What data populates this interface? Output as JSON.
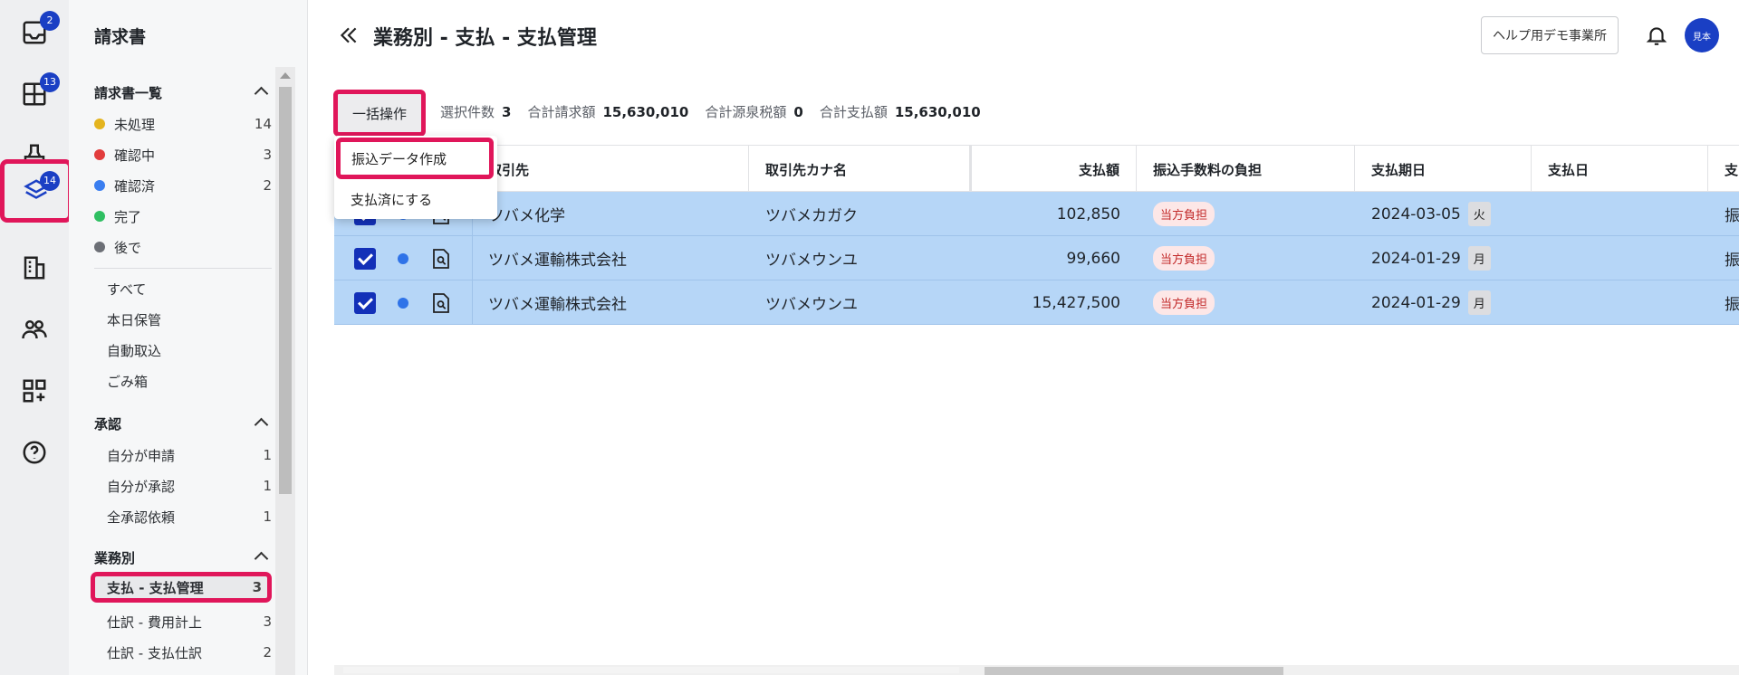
{
  "rail": {
    "items": [
      {
        "name": "inbox-icon",
        "badge": "2"
      },
      {
        "name": "grid-plus-icon",
        "badge": "13"
      },
      {
        "name": "stamp-icon",
        "badge": ""
      },
      {
        "name": "layers-icon",
        "badge": "14"
      },
      {
        "name": "building-icon",
        "badge": ""
      },
      {
        "name": "users-icon",
        "badge": ""
      },
      {
        "name": "apps-icon",
        "badge": ""
      },
      {
        "name": "help-icon",
        "badge": ""
      }
    ]
  },
  "sidebar": {
    "title": "請求書",
    "invoice_list": {
      "heading": "請求書一覧",
      "items": [
        {
          "label": "未処理",
          "count": "14",
          "color": "#e4b41e"
        },
        {
          "label": "確認中",
          "count": "3",
          "color": "#e23d3d"
        },
        {
          "label": "確認済",
          "count": "2",
          "color": "#3a7ef0"
        },
        {
          "label": "完了",
          "count": "",
          "color": "#2fbf62"
        },
        {
          "label": "後で",
          "count": "",
          "color": "#6c6f76"
        }
      ],
      "links": [
        "すべて",
        "本日保管",
        "自動取込",
        "ごみ箱"
      ]
    },
    "approval": {
      "heading": "承認",
      "items": [
        {
          "label": "自分が申請",
          "count": "1"
        },
        {
          "label": "自分が承認",
          "count": "1"
        },
        {
          "label": "全承認依頼",
          "count": "1"
        }
      ]
    },
    "business": {
      "heading": "業務別",
      "items": [
        {
          "label": "支払 - 支払管理",
          "count": "3"
        },
        {
          "label": "仕訳 - 費用計上",
          "count": "3"
        },
        {
          "label": "仕訳 - 支払仕訳",
          "count": "2"
        }
      ]
    }
  },
  "header": {
    "title": "業務別 - 支払 - 支払管理",
    "office_button": "ヘルプ用デモ事業所",
    "avatar_text": "見本"
  },
  "toolbar": {
    "bulk_label": "一括操作",
    "selected_label": "選択件数",
    "selected_value": "3",
    "total_billed_label": "合計請求額",
    "total_billed_value": "15,630,010",
    "withholding_label": "合計源泉税額",
    "withholding_value": "0",
    "total_payment_label": "合計支払額",
    "total_payment_value": "15,630,010"
  },
  "menu": {
    "items": [
      "振込データ作成",
      "支払済にする"
    ]
  },
  "table": {
    "headers": [
      "取引先",
      "取引先カナ名",
      "支払額",
      "振込手数料の負担",
      "支払期日",
      "支払日",
      "支"
    ],
    "rows": [
      {
        "partner": "ツバメ化学",
        "kana": "ツバメカガク",
        "amount": "102,850",
        "fee": "当方負担",
        "due": "2024-03-05",
        "weekday": "火",
        "paid": "",
        "extra": "振"
      },
      {
        "partner": "ツバメ運輸株式会社",
        "kana": "ツバメウンユ",
        "amount": "99,660",
        "fee": "当方負担",
        "due": "2024-01-29",
        "weekday": "月",
        "paid": "",
        "extra": "振"
      },
      {
        "partner": "ツバメ運輸株式会社",
        "kana": "ツバメウンユ",
        "amount": "15,427,500",
        "fee": "当方負担",
        "due": "2024-01-29",
        "weekday": "月",
        "paid": "",
        "extra": "振"
      }
    ]
  },
  "colors": {
    "accent": "#1a3fc4",
    "highlight": "#e0165a",
    "selected_row": "#b6d6f7"
  }
}
